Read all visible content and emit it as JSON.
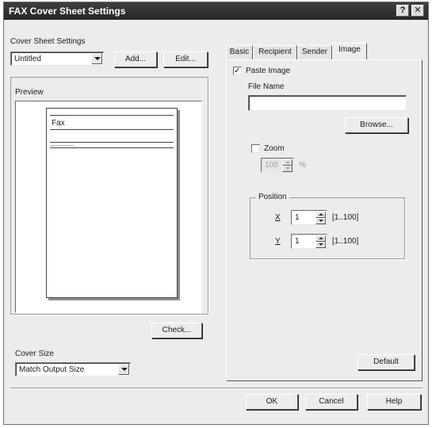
{
  "window": {
    "title": "FAX Cover Sheet Settings",
    "help_glyph": "?",
    "close_glyph": "✕"
  },
  "cover_sheet_settings": {
    "label": "Cover Sheet Settings",
    "selected": "Untitled",
    "add_label": "Add...",
    "edit_label": "Edit..."
  },
  "preview": {
    "label": "Preview",
    "fax_text": "Fax",
    "check_label": "Check..."
  },
  "cover_size": {
    "label": "Cover Size",
    "selected": "Match Output Size"
  },
  "tabs": [
    {
      "label": "Basic"
    },
    {
      "label": "Recipient"
    },
    {
      "label": "Sender"
    },
    {
      "label": "Image"
    }
  ],
  "image_tab": {
    "paste_image_label": "Paste Image",
    "paste_image_checked": true,
    "file_name_label": "File Name",
    "file_name_value": "",
    "browse_label": "Browse...",
    "zoom_label": "Zoom",
    "zoom_checked": false,
    "zoom_value": "100",
    "zoom_unit": "%",
    "position_label": "Position",
    "x_label": "X",
    "x_value": "1",
    "x_range": "[1..100]",
    "y_label": "Y",
    "y_value": "1",
    "y_range": "[1..100]",
    "default_label": "Default"
  },
  "footer": {
    "ok_label": "OK",
    "cancel_label": "Cancel",
    "help_label": "Help"
  }
}
